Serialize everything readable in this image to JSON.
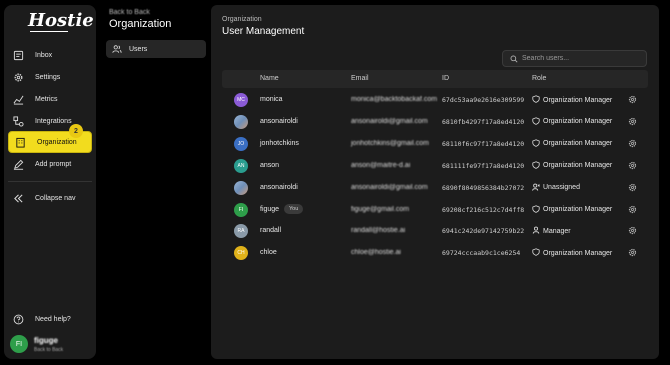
{
  "app": {
    "logo_text": "Hostie"
  },
  "sidebar": {
    "items": [
      {
        "label": "Inbox",
        "icon": "inbox-icon"
      },
      {
        "label": "Settings",
        "icon": "gear-icon"
      },
      {
        "label": "Metrics",
        "icon": "chart-icon"
      },
      {
        "label": "Integrations",
        "icon": "integrations-icon"
      },
      {
        "label": "Organization",
        "icon": "building-icon"
      },
      {
        "label": "Add prompt",
        "icon": "pen-icon"
      }
    ],
    "collapse_label": "Collapse nav",
    "help_label": "Need help?",
    "step_badge": "2",
    "user": {
      "initials": "FI",
      "name": "figuge",
      "sub": "Back to Back"
    },
    "active_color": "#f2dc1e"
  },
  "subnav": {
    "back_label": "Back to Back",
    "title": "Organization",
    "items": [
      {
        "label": "Users",
        "icon": "users-icon"
      }
    ]
  },
  "main": {
    "section": "Organization",
    "title": "User Management",
    "search_placeholder": "Search users...",
    "columns": [
      "Name",
      "Email",
      "ID",
      "Role"
    ],
    "rows": [
      {
        "initials": "MC",
        "avatar_color": "#8b5bd6",
        "name": "monica",
        "email": "monica@backtobackaf.com",
        "id": "67dc53aa9e2616e309599",
        "role": "Organization Manager",
        "role_icon": "shield-icon"
      },
      {
        "initials": "",
        "avatar_color": "photo",
        "name": "ansonairoldi",
        "email": "ansonairoldi@gmail.com",
        "id": "6810fb4297f17a8ed4120",
        "role": "Organization Manager",
        "role_icon": "shield-icon"
      },
      {
        "initials": "JO",
        "avatar_color": "#3a6fc4",
        "name": "jonhotchkins",
        "email": "jonhotchkins@gmail.com",
        "id": "68110f6c97f17a8ed4120",
        "role": "Organization Manager",
        "role_icon": "shield-icon"
      },
      {
        "initials": "AN",
        "avatar_color": "#2a9d8f",
        "name": "anson",
        "email": "anson@maitre-d.ai",
        "id": "681111fe97f17a8ed4120",
        "role": "Organization Manager",
        "role_icon": "shield-icon"
      },
      {
        "initials": "",
        "avatar_color": "photo",
        "name": "ansonairoldi",
        "email": "ansonairoldi@gmail.com",
        "id": "6890f8049856384b27072",
        "role": "Unassigned",
        "role_icon": "user-x-icon"
      },
      {
        "initials": "FI",
        "avatar_color": "#2e9e4a",
        "name": "figuge",
        "you_label": "You",
        "email": "figuge@gmail.com",
        "id": "69208cf216c512c7d4ff8",
        "role": "Organization Manager",
        "role_icon": "shield-icon"
      },
      {
        "initials": "RA",
        "avatar_color": "#8a9aa8",
        "name": "randall",
        "email": "randall@hostie.ai",
        "id": "6941c242de97142759b22",
        "role": "Manager",
        "role_icon": "user-icon"
      },
      {
        "initials": "CH",
        "avatar_color": "#e0b21a",
        "name": "chloe",
        "email": "chloe@hostie.ai",
        "id": "69724cccaab9c1ce6254",
        "role": "Organization Manager",
        "role_icon": "shield-icon"
      }
    ]
  }
}
